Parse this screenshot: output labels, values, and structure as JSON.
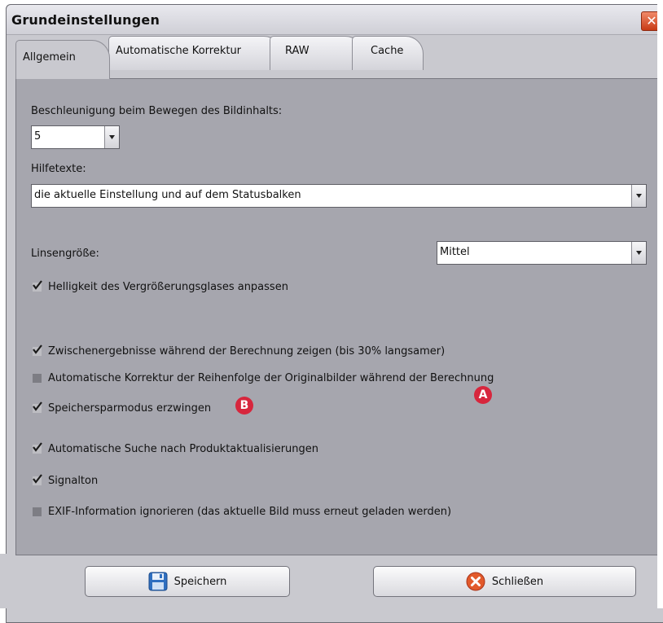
{
  "window": {
    "title": "Grundeinstellungen",
    "close_glyph": "✕"
  },
  "tabs": [
    {
      "label": "Allgemein",
      "active": true
    },
    {
      "label": "Automatische Korrektur",
      "active": false
    },
    {
      "label": "RAW",
      "active": false
    },
    {
      "label": "Cache",
      "active": false
    }
  ],
  "general": {
    "acceleration_label": "Beschleunigung beim Bewegen des Bildinhalts:",
    "acceleration_value": "5",
    "helptexts_label": "Hilfetexte:",
    "helptexts_value": "die aktuelle Einstellung und auf dem Statusbalken",
    "lens_size_label": "Linsengröße:",
    "lens_size_value": "Mittel",
    "checkboxes": [
      {
        "label": "Helligkeit des Vergrößerungsglases anpassen",
        "checked": true
      },
      {
        "label": "Zwischenergebnisse während der Berechnung zeigen (bis 30% langsamer)",
        "checked": true
      },
      {
        "label": "Automatische Korrektur der Reihenfolge der Originalbilder während der Berechnung",
        "checked": false
      },
      {
        "label": "Speichersparmodus erzwingen",
        "checked": true
      },
      {
        "label": "Automatische Suche nach Produktaktualisierungen",
        "checked": true
      },
      {
        "label": "Signalton",
        "checked": true
      },
      {
        "label": "EXIF-Information ignorieren (das aktuelle Bild muss erneut geladen werden)",
        "checked": false
      }
    ]
  },
  "markers": {
    "a": "A",
    "b": "B",
    "color": "#d7263d"
  },
  "buttons": {
    "save_label": "Speichern",
    "close_label": "Schließen"
  },
  "icons": {
    "save": "floppy-disk-icon",
    "close": "red-x-circle-icon",
    "dropdown": "chevron-down-icon"
  }
}
